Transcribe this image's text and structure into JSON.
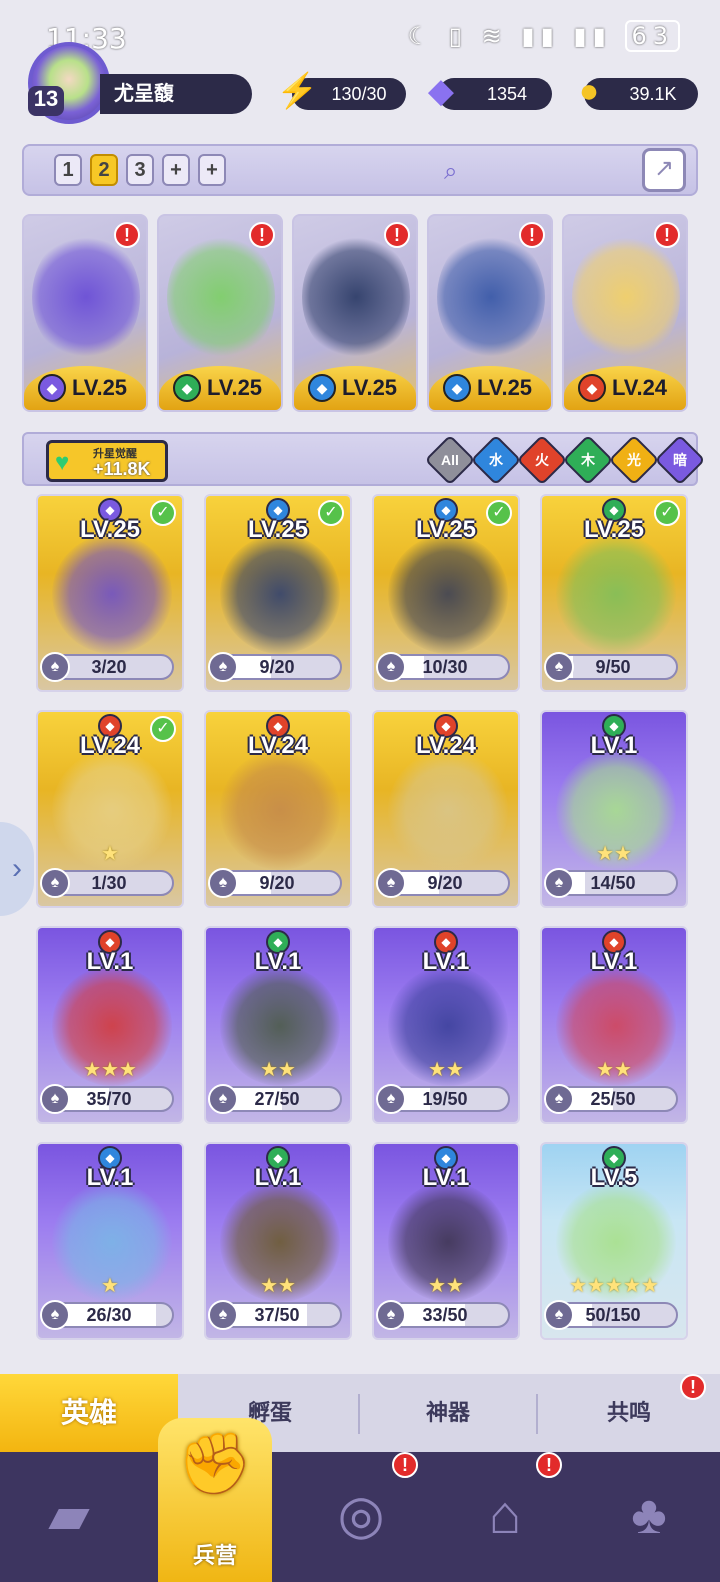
{
  "status": {
    "time": "11:33",
    "battery": "63"
  },
  "player": {
    "level": "13",
    "name": "尤呈馥"
  },
  "resources": [
    {
      "value": "130/30",
      "icon": "energy-bolt-icon",
      "color": "#3fdc57"
    },
    {
      "value": "1354",
      "icon": "gem-icon",
      "color": "#8a72f0"
    },
    {
      "value": "39.1K",
      "icon": "gold-coin-icon",
      "color": "#f5c425"
    }
  ],
  "team_tabs": [
    "1",
    "2",
    "3",
    "+",
    "+"
  ],
  "team_active": 1,
  "team": [
    {
      "lv": "LV.25",
      "element": "dark",
      "elem_color": "#7a5ae0",
      "art": "#6b4fd6"
    },
    {
      "lv": "LV.25",
      "element": "nature",
      "elem_color": "#2fae57",
      "art": "#7fcf6a"
    },
    {
      "lv": "LV.25",
      "element": "water",
      "elem_color": "#2f86dd",
      "art": "#2f3e69"
    },
    {
      "lv": "LV.25",
      "element": "water",
      "elem_color": "#2f86dd",
      "art": "#3b5aa8"
    },
    {
      "lv": "LV.24",
      "element": "fire",
      "elem_color": "#e0432a",
      "art": "#f1d069"
    }
  ],
  "awaken": {
    "title": "升星觉醒",
    "value": "+11.8K"
  },
  "filters": [
    {
      "label": "All",
      "color": "#8f8f9a"
    },
    {
      "label": "水",
      "color": "#2f86dd"
    },
    {
      "label": "火",
      "color": "#e0432a"
    },
    {
      "label": "木",
      "color": "#2fae57"
    },
    {
      "label": "光",
      "color": "#f0b014"
    },
    {
      "label": "暗",
      "color": "#7a5ae0"
    }
  ],
  "heroes": [
    {
      "lv": "LV.25",
      "elem_color": "#7a5ae0",
      "frame": "gold",
      "check": true,
      "progress": "3/20",
      "fraction": 0.15,
      "stars": "",
      "art": "#6d4fc8"
    },
    {
      "lv": "LV.25",
      "elem_color": "#2f86dd",
      "frame": "gold",
      "check": true,
      "progress": "9/20",
      "fraction": 0.45,
      "stars": "",
      "art": "#2e3f70"
    },
    {
      "lv": "LV.25",
      "elem_color": "#2f86dd",
      "frame": "gold",
      "check": true,
      "progress": "10/30",
      "fraction": 0.33,
      "stars": "",
      "art": "#3a3f55"
    },
    {
      "lv": "LV.25",
      "elem_color": "#2fae57",
      "frame": "gold",
      "check": true,
      "progress": "9/50",
      "fraction": 0.18,
      "stars": "",
      "art": "#7fbf5a"
    },
    {
      "lv": "LV.24",
      "elem_color": "#e0432a",
      "frame": "gold",
      "check": true,
      "progress": "1/30",
      "fraction": 0.03,
      "stars": "★",
      "art": "#e6cf86"
    },
    {
      "lv": "LV.24",
      "elem_color": "#e0432a",
      "frame": "gold",
      "check": false,
      "progress": "9/20",
      "fraction": 0.45,
      "stars": "",
      "art": "#c58a4a"
    },
    {
      "lv": "LV.24",
      "elem_color": "#e0432a",
      "frame": "gold",
      "check": false,
      "progress": "9/20",
      "fraction": 0.45,
      "stars": "",
      "art": "#d9c58a"
    },
    {
      "lv": "LV.1",
      "elem_color": "#2fae57",
      "frame": "purple",
      "check": false,
      "progress": "14/50",
      "fraction": 0.28,
      "stars": "★★",
      "art": "#a8e08c"
    },
    {
      "lv": "LV.1",
      "elem_color": "#e0432a",
      "frame": "purple",
      "check": false,
      "progress": "35/70",
      "fraction": 0.5,
      "stars": "★★★",
      "art": "#d33b3b"
    },
    {
      "lv": "LV.1",
      "elem_color": "#2fae57",
      "frame": "purple",
      "check": false,
      "progress": "27/50",
      "fraction": 0.54,
      "stars": "★★",
      "art": "#4a5a46"
    },
    {
      "lv": "LV.1",
      "elem_color": "#e0432a",
      "frame": "purple",
      "check": false,
      "progress": "19/50",
      "fraction": 0.38,
      "stars": "★★",
      "art": "#3a3f9a"
    },
    {
      "lv": "LV.1",
      "elem_color": "#e0432a",
      "frame": "purple",
      "check": false,
      "progress": "25/50",
      "fraction": 0.5,
      "stars": "★★",
      "art": "#d1455a"
    },
    {
      "lv": "LV.1",
      "elem_color": "#2f86dd",
      "frame": "purple",
      "check": false,
      "progress": "26/30",
      "fraction": 0.87,
      "stars": "★",
      "art": "#7ab5e6"
    },
    {
      "lv": "LV.1",
      "elem_color": "#2fae57",
      "frame": "purple",
      "check": false,
      "progress": "37/50",
      "fraction": 0.74,
      "stars": "★★",
      "art": "#6b5a2e"
    },
    {
      "lv": "LV.1",
      "elem_color": "#2f86dd",
      "frame": "purple",
      "check": false,
      "progress": "33/50",
      "fraction": 0.66,
      "stars": "★★",
      "art": "#3c3350"
    },
    {
      "lv": "LV.5",
      "elem_color": "#2fae57",
      "frame": "blue",
      "check": false,
      "progress": "50/150",
      "fraction": 0.33,
      "stars": "★★★★★",
      "art": "#a7e08a"
    }
  ],
  "bottom_tabs": [
    "英雄",
    "孵蛋",
    "神器",
    "共鸣"
  ],
  "nav": {
    "active_label": "兵营"
  }
}
